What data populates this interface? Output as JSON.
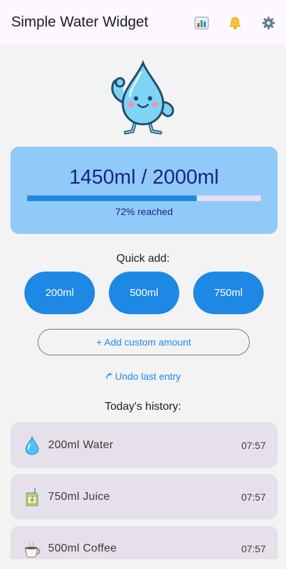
{
  "app": {
    "title": "Simple Water Widget",
    "icons": [
      "chart-icon",
      "bell-icon",
      "gear-icon"
    ]
  },
  "progress": {
    "consumed": "1450ml",
    "separator": "/",
    "goal": "2000ml",
    "percent_text": "72% reached",
    "fraction": 0.725,
    "track_color": "#e8e0ef",
    "fill_color": "#1e88e5",
    "card_color": "#90caf9"
  },
  "quick_add": {
    "label": "Quick add:",
    "buttons": [
      {
        "label": "200ml"
      },
      {
        "label": "500ml"
      },
      {
        "label": "750ml"
      }
    ]
  },
  "custom_button": {
    "label": "+ Add custom amount"
  },
  "undo_button": {
    "icon": "undo-icon",
    "label": "Undo last entry"
  },
  "history": {
    "label": "Today's history:",
    "items": [
      {
        "icon": "water-drop-icon",
        "text": "200ml Water",
        "time": "07:57"
      },
      {
        "icon": "juice-box-icon",
        "text": "750ml Juice",
        "time": "07:57"
      },
      {
        "icon": "coffee-cup-icon",
        "text": "500ml Coffee",
        "time": "07:57"
      }
    ]
  },
  "colors": {
    "accent": "#1e88e5",
    "history_item_bg": "#e6e0ea",
    "background": "#f3f3f3"
  }
}
